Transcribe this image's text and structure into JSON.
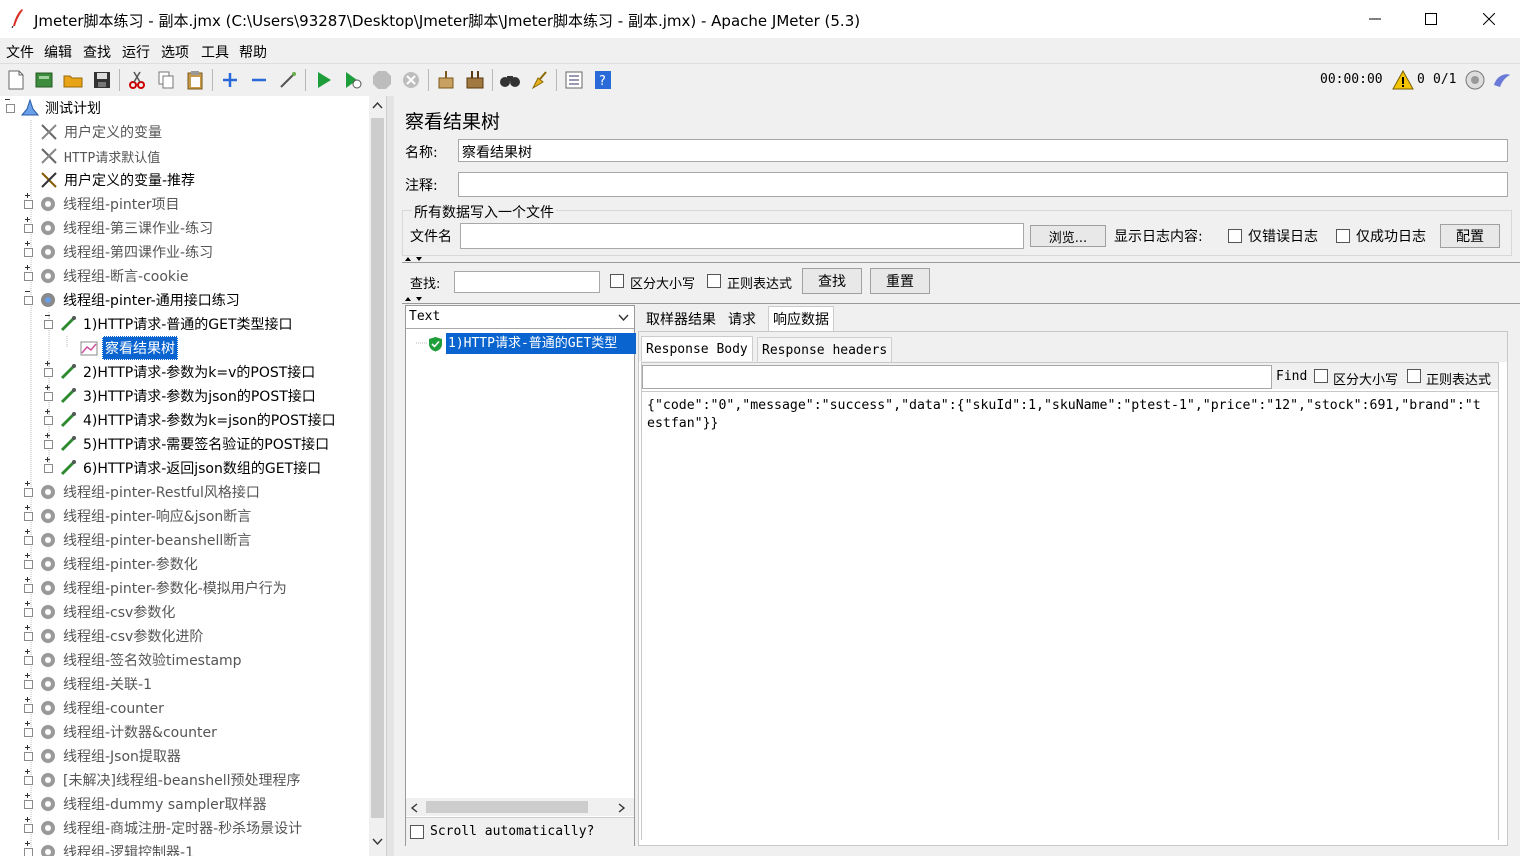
{
  "window": {
    "title": "Jmeter脚本练习 - 副本.jmx (C:\\Users\\93287\\Desktop\\Jmeter脚本\\Jmeter脚本练习 - 副本.jmx) - Apache JMeter (5.3)"
  },
  "menu": [
    "文件",
    "编辑",
    "查找",
    "运行",
    "选项",
    "工具",
    "帮助"
  ],
  "toolbar": {
    "timer": "00:00:00",
    "error_count": "0",
    "threads": "0/1"
  },
  "tree": {
    "root": "测试计划",
    "items": [
      "用户定义的变量",
      "HTTP请求默认值",
      "用户定义的变量-推荐",
      "线程组-pinter项目",
      "线程组-第三课作业-练习",
      "线程组-第四课作业-练习",
      "线程组-断言-cookie",
      "线程组-pinter-通用接口练习",
      "1)HTTP请求-普通的GET类型接口",
      "察看结果树",
      "2)HTTP请求-参数为k=v的POST接口",
      "3)HTTP请求-参数为json的POST接口",
      "4)HTTP请求-参数为k=json的POST接口",
      "5)HTTP请求-需要签名验证的POST接口",
      "6)HTTP请求-返回json数组的GET接口",
      "线程组-pinter-Restful风格接口",
      "线程组-pinter-响应&json断言",
      "线程组-pinter-beanshell断言",
      "线程组-pinter-参数化",
      "线程组-pinter-参数化-模拟用户行为",
      "线程组-csv参数化",
      "线程组-csv参数化进阶",
      "线程组-签名效验timestamp",
      "线程组-关联-1",
      "线程组-counter",
      "线程组-计数器&counter",
      "线程组-Json提取器",
      "[未解决]线程组-beanshell预处理程序",
      "线程组-dummy sampler取样器",
      "线程组-商城注册-定时器-秒杀场景设计",
      "线程组-逻辑控制器-1"
    ]
  },
  "panel": {
    "heading": "察看结果树",
    "name_label": "名称:",
    "name_value": "察看结果树",
    "comment_label": "注释:",
    "comment_value": "",
    "file_section_title": "所有数据写入一个文件",
    "file_label": "文件名",
    "file_value": "",
    "browse_button": "浏览...",
    "log_label": "显示日志内容:",
    "errors_only": "仅错误日志",
    "success_only": "仅成功日志",
    "config_button": "配置",
    "search_label": "查找:",
    "search_value": "",
    "case_sensitive": "区分大小写",
    "regex": "正则表达式",
    "find_button": "查找",
    "reset_button": "重置"
  },
  "results": {
    "renderer": "Text",
    "sample": "1)HTTP请求-普通的GET类型",
    "scroll_auto": "Scroll automatically?"
  },
  "tabs": {
    "main": [
      "取样器结果",
      "请求",
      "响应数据"
    ],
    "sub": [
      "Response Body",
      "Response headers"
    ]
  },
  "response": {
    "find_label": "Find",
    "case_sensitive": "区分大小写",
    "regex": "正则表达式",
    "line1": "{\"code\":\"0\",\"message\":\"success\",\"data\":{\"skuId\":1,\"skuName\":\"ptest-1\",\"price\":\"12\",\"stock\":691,\"brand\":\"t",
    "line2": "estfan\"}}"
  }
}
